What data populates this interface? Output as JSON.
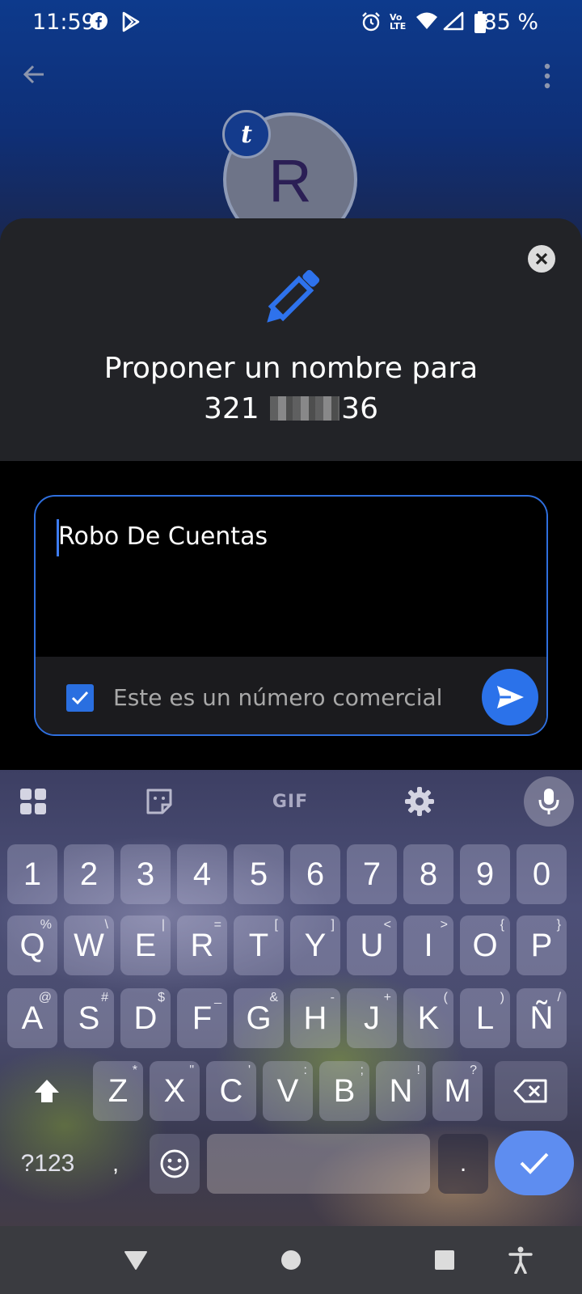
{
  "status_bar": {
    "time": "11:59",
    "battery": "85 %",
    "icons": [
      "facebook-icon",
      "play-store-icon",
      "alarm-icon",
      "volte-icon",
      "wifi-icon",
      "signal-icon",
      "battery-icon"
    ]
  },
  "app_bar": {
    "back_icon": "arrow-back-icon",
    "menu_icon": "more-vert-icon"
  },
  "contact": {
    "avatar_letter": "R",
    "badge_letter": "t"
  },
  "sheet": {
    "title": "Proponer un nombre para",
    "number_prefix": "321",
    "number_suffix": "36",
    "close_icon": "close-icon",
    "header_icon": "pencil-icon"
  },
  "form": {
    "name_value": "Robo De Cuentas",
    "business_label": "Este es un número comercial",
    "business_checked": true,
    "send_icon": "send-icon"
  },
  "keyboard": {
    "toolbar": {
      "apps_icon": "grid-icon",
      "sticker_icon": "sticker-icon",
      "gif_label": "GIF",
      "settings_icon": "gear-icon",
      "mic_icon": "mic-icon"
    },
    "number_row": [
      "1",
      "2",
      "3",
      "4",
      "5",
      "6",
      "7",
      "8",
      "9",
      "0"
    ],
    "row1": [
      {
        "key": "Q",
        "hint": "%"
      },
      {
        "key": "W",
        "hint": "\\"
      },
      {
        "key": "E",
        "hint": "|"
      },
      {
        "key": "R",
        "hint": "="
      },
      {
        "key": "T",
        "hint": "["
      },
      {
        "key": "Y",
        "hint": "]"
      },
      {
        "key": "U",
        "hint": "<"
      },
      {
        "key": "I",
        "hint": ">"
      },
      {
        "key": "O",
        "hint": "{"
      },
      {
        "key": "P",
        "hint": "}"
      }
    ],
    "row2": [
      {
        "key": "A",
        "hint": "@"
      },
      {
        "key": "S",
        "hint": "#"
      },
      {
        "key": "D",
        "hint": "$"
      },
      {
        "key": "F",
        "hint": "_"
      },
      {
        "key": "G",
        "hint": "&"
      },
      {
        "key": "H",
        "hint": "-"
      },
      {
        "key": "J",
        "hint": "+"
      },
      {
        "key": "K",
        "hint": "("
      },
      {
        "key": "L",
        "hint": ")"
      },
      {
        "key": "Ñ",
        "hint": "/"
      }
    ],
    "row3": [
      {
        "key": "Z",
        "hint": "*"
      },
      {
        "key": "X",
        "hint": "\""
      },
      {
        "key": "C",
        "hint": "'"
      },
      {
        "key": "V",
        "hint": ":"
      },
      {
        "key": "B",
        "hint": ";"
      },
      {
        "key": "N",
        "hint": "!"
      },
      {
        "key": "M",
        "hint": "?"
      }
    ],
    "symbols_label": "?123",
    "comma_label": ",",
    "period_label": ".",
    "shift_icon": "shift-icon",
    "backspace_icon": "backspace-icon",
    "emoji_icon": "emoji-icon",
    "enter_icon": "check-icon"
  },
  "nav_bar": {
    "back_icon": "nav-back-icon",
    "home_icon": "nav-home-icon",
    "recents_icon": "nav-recents-icon",
    "accessibility_icon": "accessibility-icon"
  }
}
